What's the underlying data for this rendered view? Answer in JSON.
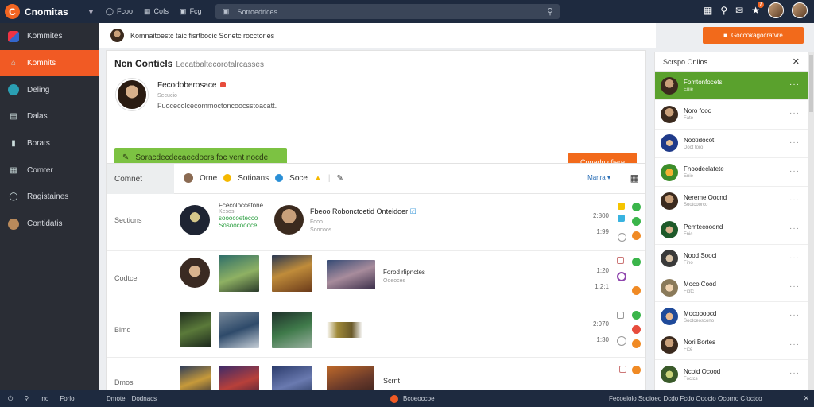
{
  "app": {
    "name": "Cnomitas"
  },
  "topnav": [
    {
      "icon": "globe-icon",
      "label": "Fcoo"
    },
    {
      "icon": "chart-icon",
      "label": "Cofs"
    },
    {
      "icon": "gallery-icon",
      "label": "Fcg"
    }
  ],
  "search": {
    "placeholder": "Sotroedrices"
  },
  "top_icons": {
    "notifications_count": "7"
  },
  "sidebar": {
    "items": [
      {
        "label": "Kommites",
        "icon": "pinwheel-icon",
        "active": false
      },
      {
        "label": "Komnits",
        "icon": "home-icon",
        "active": true
      },
      {
        "label": "Deling",
        "icon": "circle-icon",
        "active": false
      },
      {
        "label": "Dalas",
        "icon": "card-icon",
        "active": false
      },
      {
        "label": "Borats",
        "icon": "bars-icon",
        "active": false
      },
      {
        "label": "Comter",
        "icon": "calendar-icon",
        "active": false
      },
      {
        "label": "Ragistaines",
        "icon": "globe-icon",
        "active": false
      },
      {
        "label": "Contidatis",
        "icon": "avatar-icon",
        "active": false
      }
    ]
  },
  "header": {
    "breadcrumb": "Komnaitoestc taic fisrtbocic Sonetc rocctories",
    "action_button": "Goccokagocratvre"
  },
  "profile_card": {
    "title": "Ncn Contiels",
    "subtitle": "Lecatbaltecorotalrcasses",
    "name": "Fecodoberosace",
    "meta": "Secucio",
    "desc": "Fuocecolcecommoctoncoocsstoacatt.",
    "green_button": "Soracdecdecaecdocrs foc yent nocde",
    "orange_button": "Conadn cfiere"
  },
  "feed": {
    "tab": "Comnet",
    "filters": [
      "Orne",
      "Sotioans",
      "Soce"
    ],
    "menu_label": "Manra",
    "rows": [
      {
        "label": "Sections",
        "line1": "Fcecoloccetone",
        "line2": "Kesos",
        "line3": "sooocoetecco",
        "line4": "Sosoocoooce",
        "title": "Fbeoo Robonctoetid Onteidoer",
        "sub1": "Fooo",
        "sub2": "Soocoos",
        "nums": [
          "2:800",
          "1:99"
        ]
      },
      {
        "label": "Codtce",
        "title": "Forod rlipnctes",
        "sub1": "Ooeoces",
        "nums": [
          "1:20",
          "1:2:1"
        ]
      },
      {
        "label": "Bimd",
        "nums": [
          "2:970",
          "1:30"
        ]
      },
      {
        "label": "Dmos",
        "title": "Scrnt",
        "nums": []
      }
    ]
  },
  "right_panel": {
    "title": "Scrspo Onlios",
    "friends": [
      {
        "name": "Fomtonfocets",
        "status": "Enie",
        "active": true
      },
      {
        "name": "Noro fooc",
        "status": "Fato",
        "active": false
      },
      {
        "name": "Nootidocot",
        "status": "Doct toro",
        "active": false
      },
      {
        "name": "Fnoodeclatete",
        "status": "Enie",
        "active": false
      },
      {
        "name": "Nereme Oocnd",
        "status": "Sootcoorco",
        "active": false
      },
      {
        "name": "Pemtecooond",
        "status": "Fnic",
        "active": false
      },
      {
        "name": "Nood Sooci",
        "status": "Fino",
        "active": false
      },
      {
        "name": "Moco Cood",
        "status": "Fibtc",
        "active": false
      },
      {
        "name": "Mocoboocd",
        "status": "Sootceoscono",
        "active": false
      },
      {
        "name": "Nori Bortes",
        "status": "Fice",
        "active": false
      },
      {
        "name": "Ncoid Ocood",
        "status": "Foctcs",
        "active": false
      }
    ]
  },
  "bottombar": {
    "left": [
      "Ino",
      "Forlo"
    ],
    "mid": [
      "Dmote",
      "Dodnacs"
    ],
    "center": "Bcoeoccoe",
    "right": "Fecoeiolo Sodioeo Dcdo Fcdo Ooocio Ocorno Cfoctco"
  },
  "colors": {
    "accent": "#f26522",
    "topbar": "#1e2a3f",
    "sidebar": "#2a2d35",
    "green": "#7cc242"
  }
}
